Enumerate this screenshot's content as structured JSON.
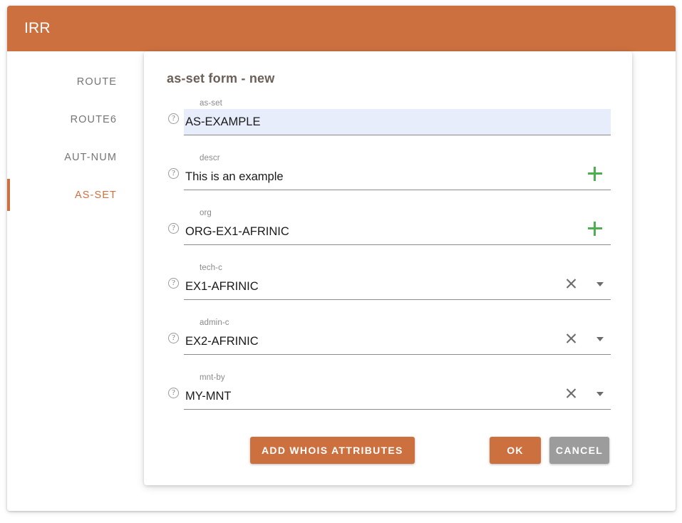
{
  "header": {
    "title": "IRR",
    "bg_color": "#CD7040"
  },
  "sidebar": {
    "items": [
      {
        "label": "ROUTE",
        "active": false
      },
      {
        "label": "ROUTE6",
        "active": false
      },
      {
        "label": "AUT-NUM",
        "active": false
      },
      {
        "label": "AS-SET",
        "active": true
      }
    ],
    "active_color": "#CD7040",
    "inactive_color": "#757575"
  },
  "form": {
    "title": "as-set form - new",
    "fields": [
      {
        "label": "as-set",
        "value": "AS-EXAMPLE",
        "help_icon": "help-circle-icon",
        "focused": true,
        "add_icon": false,
        "clear_icon": false,
        "dropdown_icon": false
      },
      {
        "label": "descr",
        "value": "This is an example",
        "help_icon": "help-circle-icon",
        "focused": false,
        "add_icon": true,
        "clear_icon": false,
        "dropdown_icon": false
      },
      {
        "label": "org",
        "value": "ORG-EX1-AFRINIC",
        "help_icon": "help-circle-icon",
        "focused": false,
        "add_icon": true,
        "clear_icon": false,
        "dropdown_icon": false
      },
      {
        "label": "tech-c",
        "value": "EX1-AFRINIC",
        "help_icon": "help-circle-icon",
        "focused": false,
        "add_icon": false,
        "clear_icon": true,
        "dropdown_icon": true
      },
      {
        "label": "admin-c",
        "value": "EX2-AFRINIC",
        "help_icon": "help-circle-icon",
        "focused": false,
        "add_icon": false,
        "clear_icon": true,
        "dropdown_icon": true
      },
      {
        "label": "mnt-by",
        "value": "MY-MNT",
        "help_icon": "help-circle-icon",
        "focused": false,
        "add_icon": false,
        "clear_icon": true,
        "dropdown_icon": true
      }
    ],
    "buttons": {
      "add_whois": "ADD WHOIS ATTRIBUTES",
      "ok": "OK",
      "cancel": "CANCEL"
    }
  },
  "colors": {
    "accent": "#CD7040",
    "add_green": "#4CAF50",
    "cancel_gray": "#9C9C9C",
    "focus_field_bg": "#E8EDFB"
  }
}
